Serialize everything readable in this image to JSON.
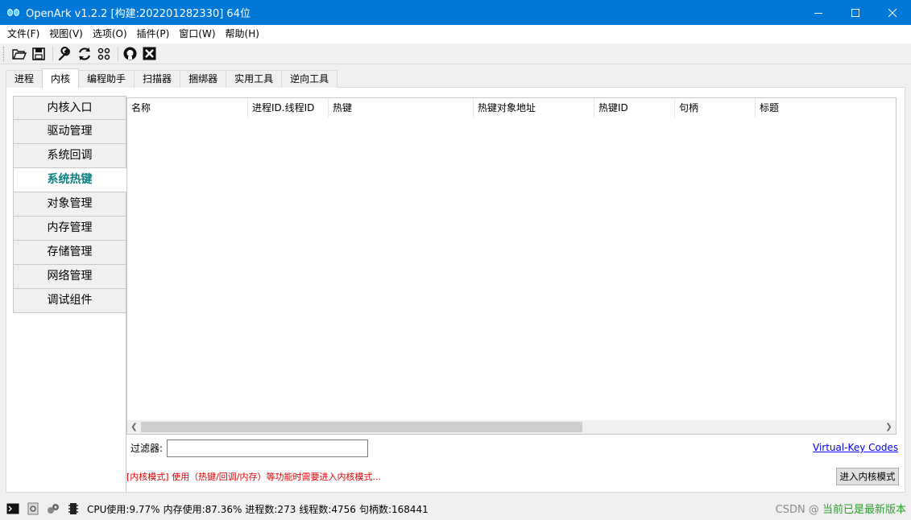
{
  "window": {
    "title": "OpenArk v1.2.2  [构建:202201282330]  64位"
  },
  "menu": [
    "文件(F)",
    "视图(V)",
    "选项(O)",
    "插件(P)",
    "窗口(W)",
    "帮助(H)"
  ],
  "toolbar_icons": [
    "folder-open-icon",
    "save-icon",
    "wrench-icon",
    "refresh-icon",
    "grid-icon",
    "github-icon",
    "close-box-icon"
  ],
  "tabs": [
    "进程",
    "内核",
    "编程助手",
    "扫描器",
    "捆绑器",
    "实用工具",
    "逆向工具"
  ],
  "active_tab": "内核",
  "kernel_nav": [
    "内核入口",
    "驱动管理",
    "系统回调",
    "系统热键",
    "对象管理",
    "内存管理",
    "存储管理",
    "网络管理",
    "调试组件"
  ],
  "active_nav": "系统热键",
  "table": {
    "columns": [
      "名称",
      "进程ID.线程ID",
      "热键",
      "热键对象地址",
      "热键ID",
      "句柄",
      "标题"
    ],
    "rows": []
  },
  "filter": {
    "label": "过滤器:",
    "value": ""
  },
  "vk_link": "Virtual-Key Codes",
  "notice": "[内核模式] 使用（热键/回调/内存）等功能时需要进入内核模式...",
  "enter_kernel_button": "进入内核模式",
  "status": {
    "cpu": "CPU使用:9.77%",
    "mem": "内存使用:87.36%",
    "procs": "进程数:273",
    "threads": "线程数:4756",
    "handles": "句柄数:168441",
    "watermark": "CSDN @",
    "version_note": "当前已是最新版本"
  },
  "colors": {
    "titlebar": "#0078d7",
    "active_nav_text": "#0a8080",
    "notice": "#e00000",
    "link": "#0000ee",
    "version_note": "#2aa02a"
  }
}
